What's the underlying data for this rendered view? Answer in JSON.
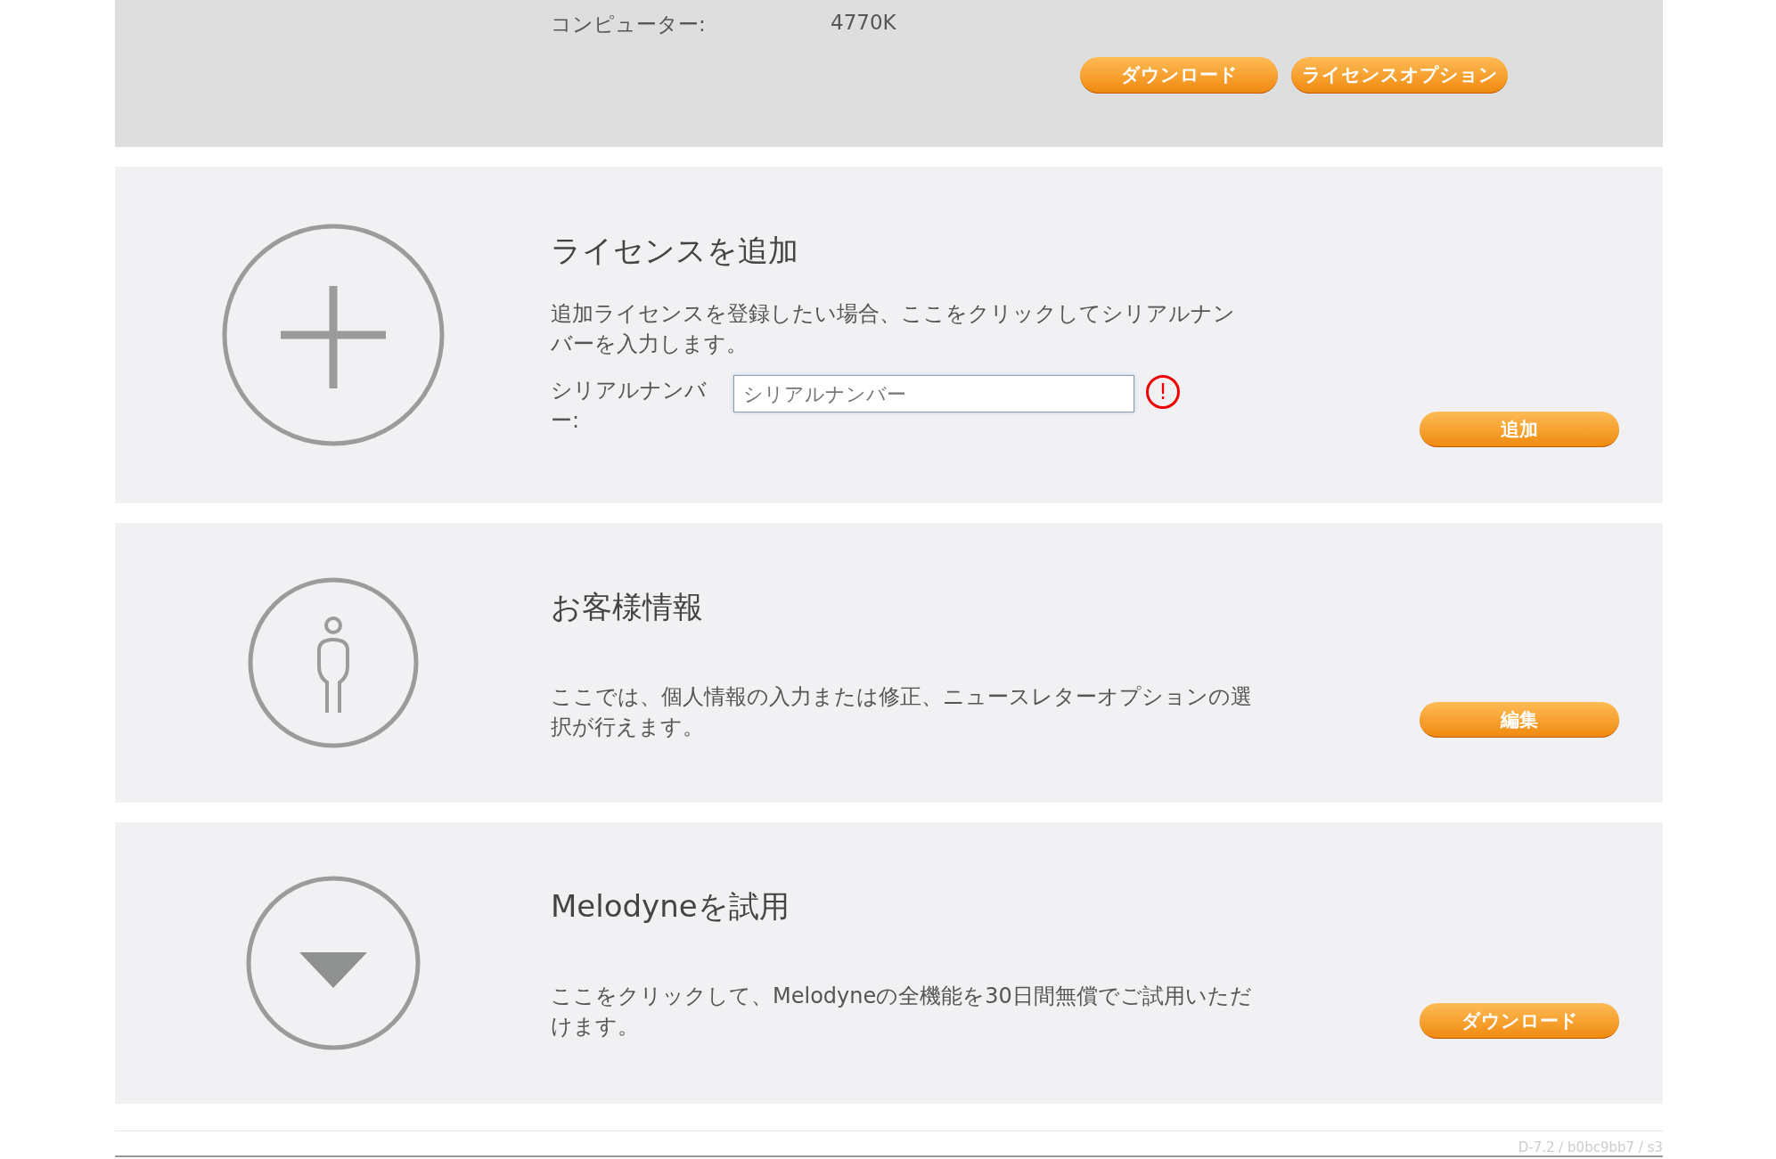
{
  "computer": {
    "label": "コンピューター:",
    "value": "4770K",
    "buttons": [
      "ダウンロード",
      "ライセンスオプション"
    ]
  },
  "sections": [
    {
      "kind": "add",
      "title": "ライセンスを追加",
      "description": "追加ライセンスを登録したい場合、ここをクリックしてシリアルナンバーを入力します。",
      "field": {
        "label": "シリアルナンバー:",
        "placeholder": "シリアルナンバー",
        "error": "!"
      },
      "button": "追加"
    },
    {
      "kind": "person",
      "title": "お客様情報",
      "description": "ここでは、個人情報の入力または修正、ニュースレターオプションの選択が行えます。",
      "button": "編集"
    },
    {
      "kind": "download",
      "title": "Melodyneを試用",
      "description": "ここをクリックして、Melodyneの全機能を30日間無償でご試用いただけます。",
      "button": "ダウンロード"
    }
  ],
  "footer": "D-7.2 / b0bc9bb7 / s3"
}
